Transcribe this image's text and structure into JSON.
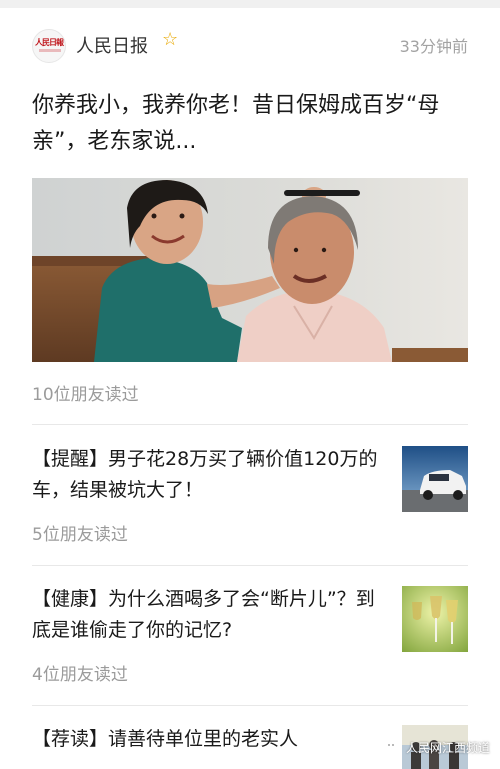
{
  "source": {
    "logo_text": "人民日報",
    "name": "人民日报",
    "time": "33分钟前"
  },
  "hero": {
    "title": "你养我小，我养你老！昔日保姆成百岁“母亲”，老东家说...",
    "read_count": "10位朋友读过"
  },
  "articles": [
    {
      "title": "【提醒】男子花28万买了辆价值120万的车，结果被坑大了！",
      "read_count": "5位朋友读过",
      "thumb_icon": "car-thumbnail"
    },
    {
      "title": "【健康】为什么酒喝多了会“断片儿”？到底是谁偷走了你的记忆?",
      "read_count": "4位朋友读过",
      "thumb_icon": "wine-glasses-thumbnail"
    },
    {
      "title": "【荐读】请善待单位里的老实人",
      "read_count": "",
      "thumb_icon": "people-thumbnail"
    }
  ],
  "watermark": {
    "text": "人民网江西频道"
  },
  "colors": {
    "star": "#e8a800",
    "muted_text": "#9b9b9b",
    "logo_red": "#c0171d"
  }
}
